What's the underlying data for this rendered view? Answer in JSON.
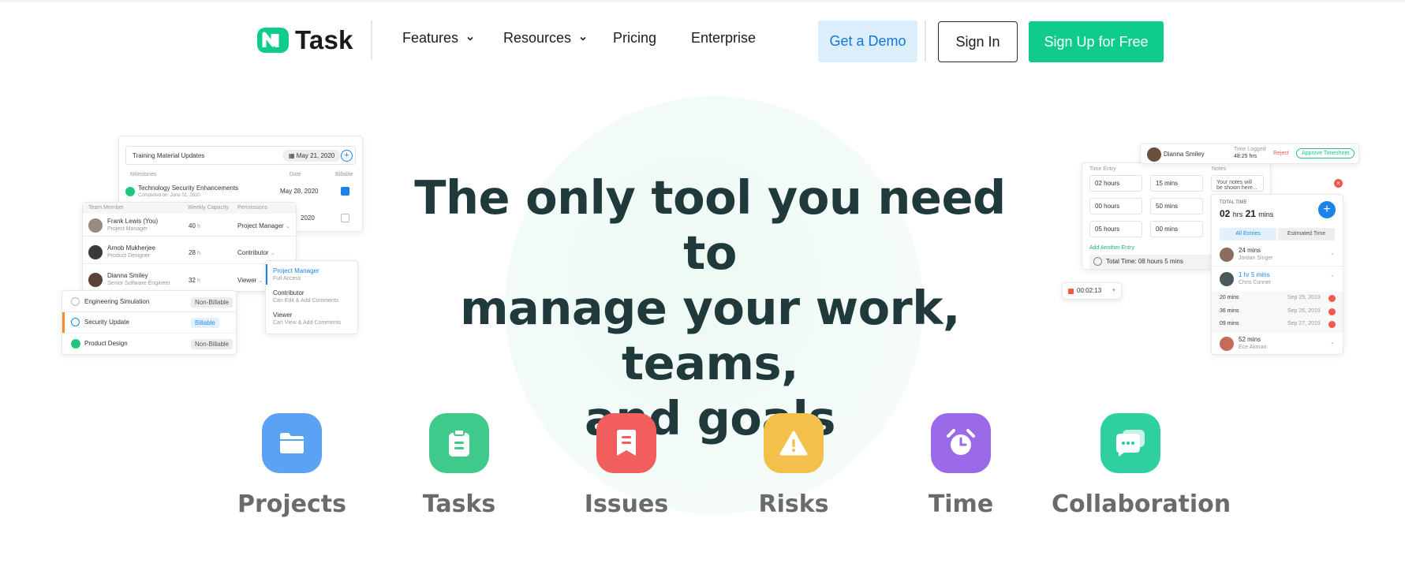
{
  "brand": {
    "name": "Task"
  },
  "nav": {
    "links": [
      {
        "label": "Features"
      },
      {
        "label": "Resources"
      },
      {
        "label": "Pricing"
      },
      {
        "label": "Enterprise"
      }
    ],
    "demo_label": "Get a Demo",
    "signin_label": "Sign In",
    "signup_label": "Sign Up for Free"
  },
  "hero": {
    "line1": "The only tool you need to",
    "line2": "manage your work, teams,",
    "line3": "and goals"
  },
  "left_mock": {
    "milestone_input": "Training Material Updates",
    "milestone_date": "May 21, 2020",
    "col_milestones": "Milestones",
    "col_date": "Date",
    "col_billable": "Billable",
    "milestone1_title": "Technology Security Enhancements",
    "milestone1_sub": "Completed on: June 01, 2020",
    "milestone1_date": "May 28, 2020",
    "milestone2_date": "2020",
    "team_col_member": "Team Member",
    "team_col_capacity": "Weekly Capacity",
    "team_col_perm": "Permissions",
    "members": [
      {
        "name": "Frank Lewis (You)",
        "role": "Project Manager",
        "capacity": "40",
        "perm": "Project Manager"
      },
      {
        "name": "Arnob Mukherjee",
        "role": "Product Designer",
        "capacity": "28",
        "perm": "Contributor"
      },
      {
        "name": "Dianna Smiley",
        "role": "Senior Software Engineer",
        "capacity": "32",
        "perm": "Viewer"
      }
    ],
    "hours_unit": "h",
    "perm_menu": [
      {
        "title": "Project Manager",
        "sub": "Full Access"
      },
      {
        "title": "Contributor",
        "sub": "Can Edit & Add Comments"
      },
      {
        "title": "Viewer",
        "sub": "Can View & Add Comments"
      }
    ],
    "tasks": [
      {
        "name": "Engineering Simulation",
        "tag": "Non-Billable"
      },
      {
        "name": "Security Update",
        "tag": "Billable"
      },
      {
        "name": "Product Design",
        "tag": "Non-Billable"
      }
    ]
  },
  "right_mock": {
    "approver_name": "Dianna Smiley",
    "time_logged_label": "Time Logged",
    "time_logged_value": "48:25 hrs",
    "reject_label": "Reject",
    "approve_label": "Approve Timesheet",
    "time_entry_label": "Time Entry",
    "notes_label": "Notes",
    "notes_placeholder": "Your notes will be shown here...",
    "entries": [
      {
        "hours": "02 hours",
        "mins": "15 mins"
      },
      {
        "hours": "00 hours",
        "mins": "50 mins"
      },
      {
        "hours": "05 hours",
        "mins": "00 mins"
      }
    ],
    "add_entry_label": "Add Another Entry",
    "total_time_label": "Total Time: 08 hours 5 mins",
    "timer_value": "00:02:13",
    "total_time_title": "TOTAL TIME",
    "total_hrs": "02",
    "hrs_unit": "hrs",
    "total_mins": "21",
    "mins_unit": "mins",
    "tab_all": "All Entries",
    "tab_estimated": "Estimated Time",
    "log1_time": "24 mins",
    "log1_name": "Jordan Singer",
    "log2_time": "1 hr 5 mins",
    "log2_name": "Chris Conner",
    "sub_entries": [
      {
        "time": "20 mins",
        "date": "Sep 25, 2019"
      },
      {
        "time": "36 mins",
        "date": "Sep 26, 2019"
      },
      {
        "time": "09 mins",
        "date": "Sep 27, 2019"
      }
    ],
    "log3_time": "52 mins",
    "log3_name": "Ece Akman"
  },
  "features": [
    {
      "label": "Projects",
      "color": "#5aa3f4"
    },
    {
      "label": "Tasks",
      "color": "#3fc98b"
    },
    {
      "label": "Issues",
      "color": "#f25e5e"
    },
    {
      "label": "Risks",
      "color": "#f3c04c"
    },
    {
      "label": "Time",
      "color": "#9b6ae8"
    },
    {
      "label": "Collaboration",
      "color": "#2fd0a0"
    }
  ],
  "colors": {
    "brand_green": "#0fcb8e",
    "demo_blue": "#1278d6",
    "headline": "#203a3c"
  }
}
